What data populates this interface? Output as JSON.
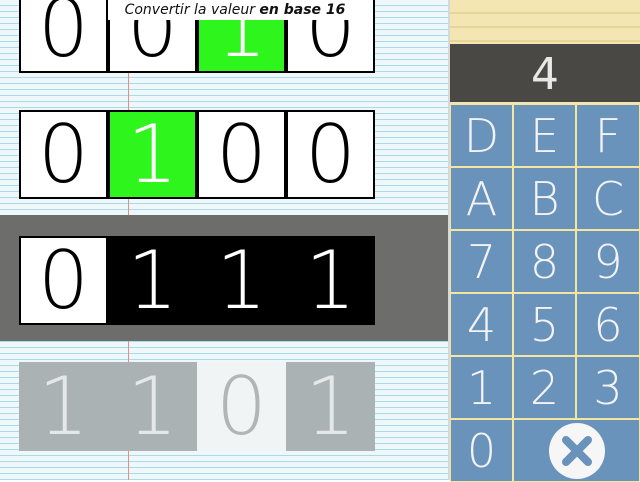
{
  "header": {
    "prefix": "Convertir la valeur ",
    "emphasis": "en base 16"
  },
  "rows": [
    {
      "bits": [
        "0",
        "0",
        "1",
        "0"
      ],
      "style": [
        "",
        "",
        "on",
        ""
      ]
    },
    {
      "bits": [
        "0",
        "1",
        "0",
        "0"
      ],
      "style": [
        "",
        "on",
        "",
        ""
      ]
    },
    {
      "bits": [
        "0",
        "1",
        "1",
        "1"
      ],
      "style": [
        "",
        "dark",
        "dark",
        "dark"
      ]
    },
    {
      "bits": [
        "1",
        "1",
        "0",
        "1"
      ],
      "style": [
        "ghost",
        "ghost",
        "ghost-w",
        "ghost"
      ]
    }
  ],
  "display": {
    "value": "4"
  },
  "keypad": {
    "keys": [
      [
        "D",
        "E",
        "F"
      ],
      [
        "A",
        "B",
        "C"
      ],
      [
        "7",
        "8",
        "9"
      ],
      [
        "4",
        "5",
        "6"
      ],
      [
        "1",
        "2",
        "3"
      ]
    ],
    "zero": "0",
    "clear_icon": "clear-icon"
  },
  "colors": {
    "highlight": "#2ef61c",
    "key": "#6a93bc",
    "display": "#4a4844",
    "panel": "#f2e4ae"
  }
}
